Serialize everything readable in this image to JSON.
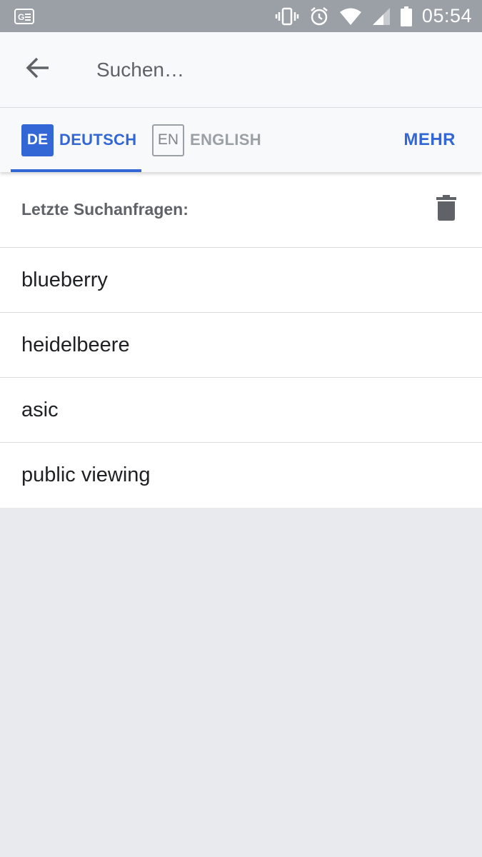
{
  "status_bar": {
    "time": "05:54",
    "icons": [
      "google-translate-notification-icon",
      "vibrate-icon",
      "alarm-icon",
      "wifi-icon",
      "signal-icon",
      "battery-icon"
    ]
  },
  "search": {
    "placeholder": "Suchen…",
    "value": "",
    "back_icon": "arrow-left-icon"
  },
  "languages": {
    "tabs": [
      {
        "code": "DE",
        "label": "DEUTSCH",
        "active": true
      },
      {
        "code": "EN",
        "label": "ENGLISH",
        "active": false
      }
    ],
    "more_label": "MEHR"
  },
  "recent": {
    "title": "Letzte Suchanfragen:",
    "clear_icon": "trash-icon",
    "items": [
      "blueberry",
      "heidelbeere",
      "asic",
      "public viewing"
    ]
  },
  "colors": {
    "accent": "#3367d6",
    "status_bar": "#9aa0a6",
    "background": "#e8eaed",
    "surface": "#ffffff"
  }
}
